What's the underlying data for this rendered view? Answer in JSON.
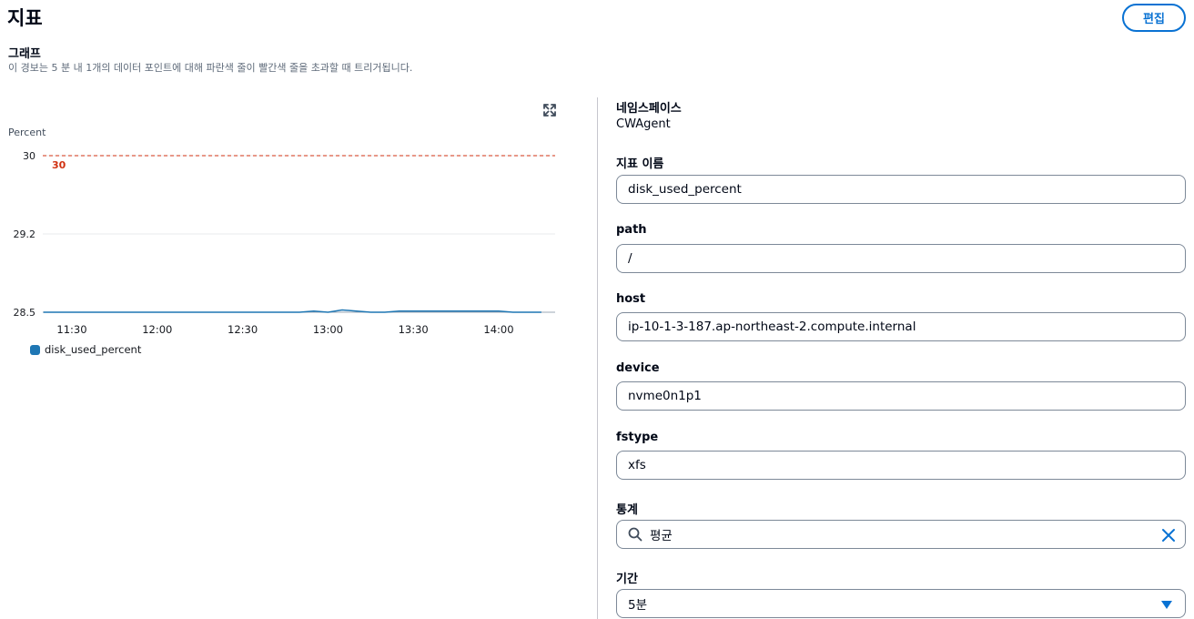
{
  "header": {
    "title": "지표",
    "edit_label": "편집"
  },
  "graph": {
    "title": "그래프",
    "description": "이 경보는 5 분 내 1개의 데이터 포인트에 대해 파란색 줄이 빨간색 줄을 초과할 때 트리거됩니다.",
    "expand_icon": "expand-icon"
  },
  "chart_data": {
    "type": "line",
    "ylabel": "Percent",
    "ylim": [
      28.5,
      30
    ],
    "y_ticks": [
      "30",
      "29.2",
      "28.5"
    ],
    "x_ticks": [
      "11:30",
      "12:00",
      "12:30",
      "13:00",
      "13:30",
      "14:00"
    ],
    "threshold": {
      "value": 30,
      "label": "30",
      "color": "#d13212"
    },
    "series": [
      {
        "name": "disk_used_percent",
        "color": "#1f77b4",
        "x": [
          "11:20",
          "11:25",
          "11:30",
          "11:35",
          "11:40",
          "11:45",
          "11:50",
          "11:55",
          "12:00",
          "12:05",
          "12:10",
          "12:15",
          "12:20",
          "12:25",
          "12:30",
          "12:35",
          "12:40",
          "12:45",
          "12:50",
          "12:55",
          "13:00",
          "13:05",
          "13:10",
          "13:15",
          "13:20",
          "13:25",
          "13:30",
          "13:35",
          "13:40",
          "13:45",
          "13:50",
          "13:55",
          "14:00",
          "14:05",
          "14:10",
          "14:15"
        ],
        "values": [
          28.5,
          28.5,
          28.5,
          28.5,
          28.5,
          28.5,
          28.5,
          28.5,
          28.5,
          28.5,
          28.5,
          28.5,
          28.5,
          28.5,
          28.5,
          28.5,
          28.5,
          28.5,
          28.5,
          28.51,
          28.5,
          28.52,
          28.51,
          28.5,
          28.5,
          28.51,
          28.51,
          28.51,
          28.51,
          28.51,
          28.51,
          28.51,
          28.51,
          28.5,
          28.5,
          28.5
        ]
      }
    ],
    "legend_position": "bottom-left"
  },
  "metric": {
    "namespace_label": "네임스페이스",
    "namespace_value": "CWAgent",
    "fields": [
      {
        "label": "지표 이름",
        "value": "disk_used_percent"
      },
      {
        "label": "path",
        "value": "/"
      },
      {
        "label": "host",
        "value": "ip-10-1-3-187.ap-northeast-2.compute.internal"
      },
      {
        "label": "device",
        "value": "nvme0n1p1"
      },
      {
        "label": "fstype",
        "value": "xfs"
      }
    ],
    "statistic": {
      "label": "통계",
      "value": "평균",
      "search_icon": "search-icon",
      "clear_icon": "close-icon"
    },
    "period": {
      "label": "기간",
      "value": "5분",
      "caret_icon": "caret-down-icon"
    }
  }
}
